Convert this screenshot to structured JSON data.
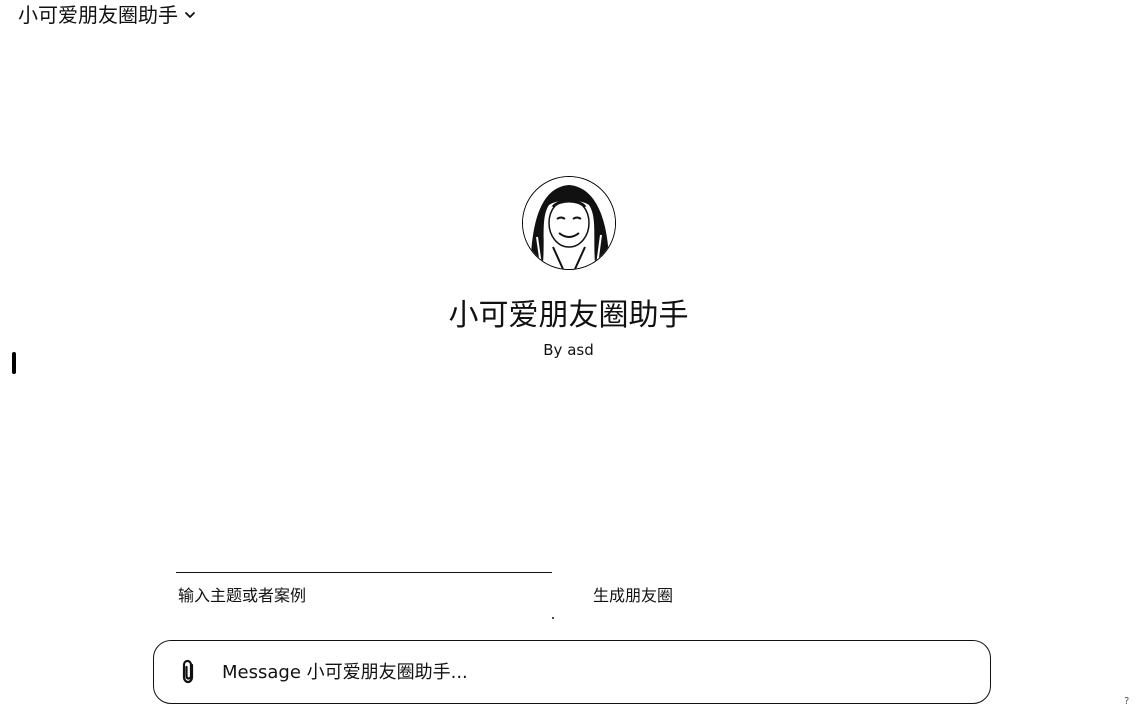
{
  "header": {
    "gpt_switcher_label": "小可爱朋友圈助手"
  },
  "hero": {
    "name": "小可爱朋友圈助手",
    "author": "By asd"
  },
  "starters": [
    {
      "label": "输入主题或者案例"
    },
    {
      "label": "生成朋友圈"
    }
  ],
  "composer": {
    "placeholder": "Message 小可爱朋友圈助手..."
  },
  "icons": {
    "chevron": "chevron-down-icon",
    "attach": "paperclip-icon",
    "help": "help-icon"
  }
}
